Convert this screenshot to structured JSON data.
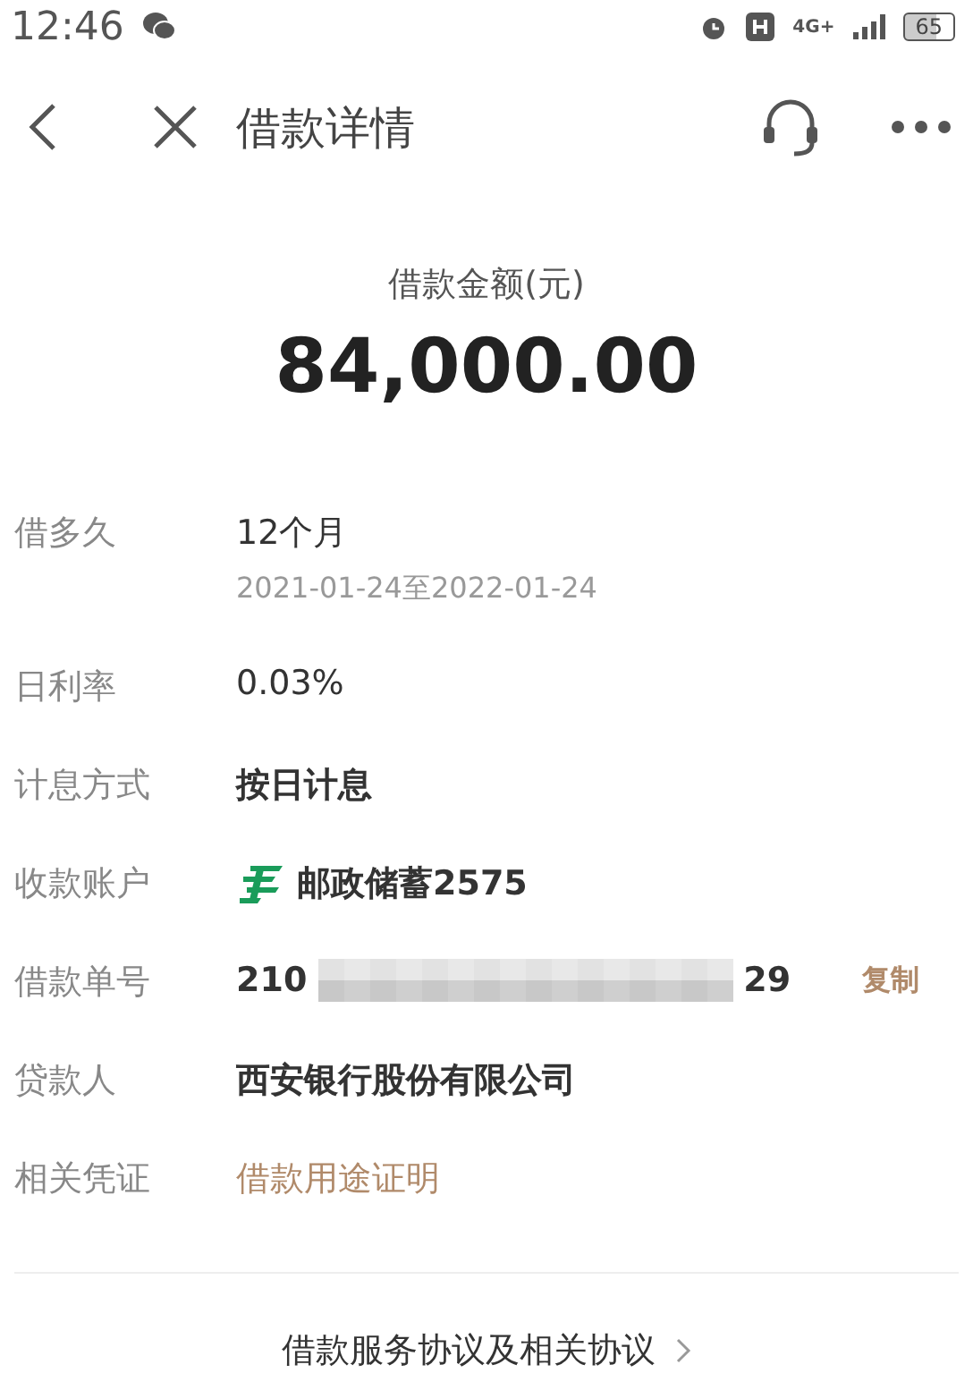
{
  "status_bar": {
    "time": "12:46",
    "network": "4G+",
    "battery": "65"
  },
  "nav": {
    "title": "借款详情"
  },
  "amount": {
    "label": "借款金额(元)",
    "value": "84,000.00"
  },
  "rows": [
    {
      "kind": "term",
      "label": "借多久",
      "value": "12个月",
      "sub": "2021-01-24至2022-01-24"
    },
    {
      "kind": "plain",
      "label": "日利率",
      "value": "0.03%"
    },
    {
      "kind": "plain",
      "label": "计息方式",
      "value": "按日计息"
    },
    {
      "kind": "account",
      "label": "收款账户",
      "value": "邮政储蓄2575"
    },
    {
      "kind": "number",
      "label": "借款单号",
      "prefix": "210",
      "suffix": "29",
      "action": "复制"
    },
    {
      "kind": "plain",
      "label": "贷款人",
      "value": "西安银行股份有限公司"
    },
    {
      "kind": "link",
      "label": "相关凭证",
      "value": "借款用途证明"
    }
  ],
  "footer": {
    "link": "借款服务协议及相关协议"
  }
}
